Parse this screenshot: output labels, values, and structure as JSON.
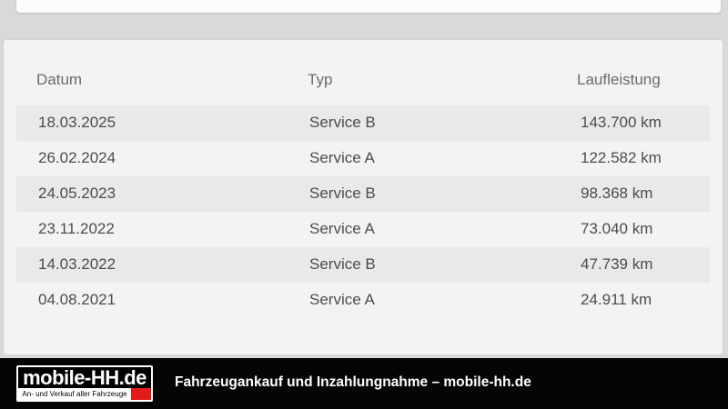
{
  "table": {
    "headers": {
      "date": "Datum",
      "type": "Typ",
      "mileage": "Laufleistung"
    },
    "rows": [
      {
        "date": "18.03.2025",
        "type": "Service B",
        "mileage": "143.700 km"
      },
      {
        "date": "26.02.2024",
        "type": "Service A",
        "mileage": "122.582 km"
      },
      {
        "date": "24.05.2023",
        "type": "Service B",
        "mileage": "98.368 km"
      },
      {
        "date": "23.11.2022",
        "type": "Service A",
        "mileage": "73.040 km"
      },
      {
        "date": "14.03.2022",
        "type": "Service B",
        "mileage": "47.739 km"
      },
      {
        "date": "04.08.2021",
        "type": "Service A",
        "mileage": "24.911 km"
      }
    ]
  },
  "footer": {
    "logo_text": "mobile-HH.de",
    "logo_subtext": "An- und Verkauf aller Fahrzeuge",
    "slogan": "Fahrzeugankauf und Inzahlungnahme – mobile-hh.de",
    "accent_color": "#e41b1b"
  }
}
